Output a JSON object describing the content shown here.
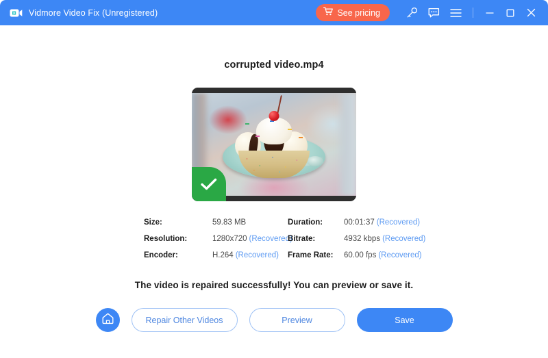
{
  "titlebar": {
    "app_name": "Vidmore Video Fix (Unregistered)",
    "logo_icon": "video-camera-icon",
    "pricing_label": "See pricing",
    "pricing_icon": "shopping-cart-icon",
    "pricing_bg": "#f8664b",
    "icons": [
      {
        "name": "key-icon",
        "title": "Register"
      },
      {
        "name": "feedback-icon",
        "title": "Feedback"
      },
      {
        "name": "menu-icon",
        "title": "Menu"
      }
    ],
    "window_controls": [
      {
        "name": "minimize-icon"
      },
      {
        "name": "maximize-icon"
      },
      {
        "name": "close-icon"
      }
    ],
    "bg": "#3d87f5"
  },
  "main": {
    "file_name": "corrupted video.mp4",
    "thumbnail": {
      "alt": "repaired video preview frame showing an ice cream sundae",
      "badge_icon": "check-icon",
      "badge_color": "#2aa845",
      "frame_color": "#2e2e2e"
    },
    "info": [
      {
        "label": "Size:",
        "value": "59.83 MB",
        "recovered": ""
      },
      {
        "label": "Duration:",
        "value": "00:01:37",
        "recovered": "(Recovered)"
      },
      {
        "label": "Resolution:",
        "value": "1280x720",
        "recovered": "(Recovered)"
      },
      {
        "label": "Bitrate:",
        "value": "4932 kbps",
        "recovered": "(Recovered)"
      },
      {
        "label": "Encoder:",
        "value": "H.264",
        "recovered": "(Recovered)"
      },
      {
        "label": "Frame Rate:",
        "value": "60.00 fps",
        "recovered": "(Recovered)"
      }
    ],
    "recovered_color": "#5c9af2",
    "success_message": "The video is repaired successfully! You can preview or save it.",
    "actions": {
      "home_icon": "home-icon",
      "repair_other_label": "Repair Other Videos",
      "preview_label": "Preview",
      "save_label": "Save",
      "primary_color": "#3d87f5"
    }
  }
}
